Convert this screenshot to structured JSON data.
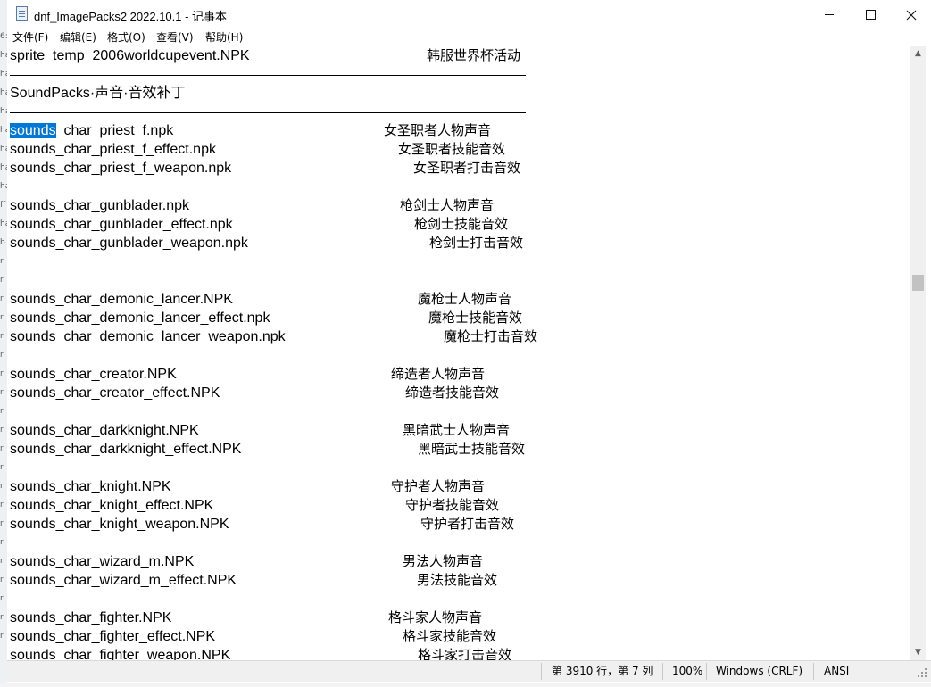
{
  "window": {
    "title": "dnf_ImagePacks2 2022.10.1 - 记事本",
    "controls": {
      "minimize": "minimize-icon",
      "maximize": "maximize-icon",
      "close": "close-icon"
    }
  },
  "left_strip_glyphs": [
    "6:",
    "ha",
    "ha",
    "ha",
    "ha",
    "ha",
    "ha",
    "ha",
    "ha",
    "ff",
    "ha",
    "b",
    "r",
    "r",
    "r",
    "r",
    "r",
    "r",
    "r",
    "r",
    "r",
    "r",
    "r",
    "r",
    "r",
    "r",
    "r",
    "r",
    "r",
    "r",
    "r",
    "r",
    "r"
  ],
  "menu": [
    "文件(F)",
    "编辑(E)",
    "格式(O)",
    "查看(V)",
    "帮助(H)"
  ],
  "editor": {
    "first_line": {
      "file": "sprite_temp_2006worldcupevent.NPK",
      "desc": "韩服世界杯活动"
    },
    "section_heading": "SoundPacks·声音·音效补丁",
    "selected_text": "sounds",
    "selected_line_rest": "_char_priest_f.npk",
    "entries": [
      {
        "file": "sounds_char_priest_f.npk",
        "desc": "女圣职者人物声音"
      },
      {
        "file": "sounds_char_priest_f_effect.npk",
        "desc": "女圣职者技能音效"
      },
      {
        "file": "sounds_char_priest_f_weapon.npk",
        "desc": "女圣职者打击音效"
      },
      {
        "file": "sounds_char_gunblader.npk",
        "desc": "枪剑士人物声音"
      },
      {
        "file": "sounds_char_gunblader_effect.npk",
        "desc": "枪剑士技能音效"
      },
      {
        "file": "sounds_char_gunblader_weapon.npk",
        "desc": "枪剑士打击音效"
      },
      {
        "file": "sounds_char_demonic_lancer.NPK",
        "desc": "魔枪士人物声音"
      },
      {
        "file": "sounds_char_demonic_lancer_effect.npk",
        "desc": "魔枪士技能音效"
      },
      {
        "file": "sounds_char_demonic_lancer_weapon.npk",
        "desc": "魔枪士打击音效"
      },
      {
        "file": "sounds_char_creator.NPK",
        "desc": "缔造者人物声音"
      },
      {
        "file": "sounds_char_creator_effect.NPK",
        "desc": "缔造者技能音效"
      },
      {
        "file": "sounds_char_darkknight.NPK",
        "desc": "黑暗武士人物声音"
      },
      {
        "file": "sounds_char_darkknight_effect.NPK",
        "desc": "黑暗武士技能音效"
      },
      {
        "file": "sounds_char_knight.NPK",
        "desc": "守护者人物声音"
      },
      {
        "file": "sounds_char_knight_effect.NPK",
        "desc": "守护者技能音效"
      },
      {
        "file": "sounds_char_knight_weapon.NPK",
        "desc": "守护者打击音效"
      },
      {
        "file": "sounds_char_wizard_m.NPK",
        "desc": "男法人物声音"
      },
      {
        "file": "sounds_char_wizard_m_effect.NPK",
        "desc": "男法技能音效"
      },
      {
        "file": "sounds_char_fighter.NPK",
        "desc": "格斗家人物声音"
      },
      {
        "file": "sounds_char_fighter_effect.NPK",
        "desc": "格斗家技能音效"
      },
      {
        "file": "sounds_char_fighter_weapon.NPK",
        "desc": "格斗家打击音效"
      }
    ]
  },
  "statusbar": {
    "position": "第 3910 行，第 7 列",
    "zoom": "100%",
    "line_ending": "Windows (CRLF)",
    "encoding": "ANSI"
  },
  "colors": {
    "selection": "#0078d7",
    "statusbar_bg": "#f0f0f0",
    "scroll_thumb": "#c2c2c2"
  }
}
